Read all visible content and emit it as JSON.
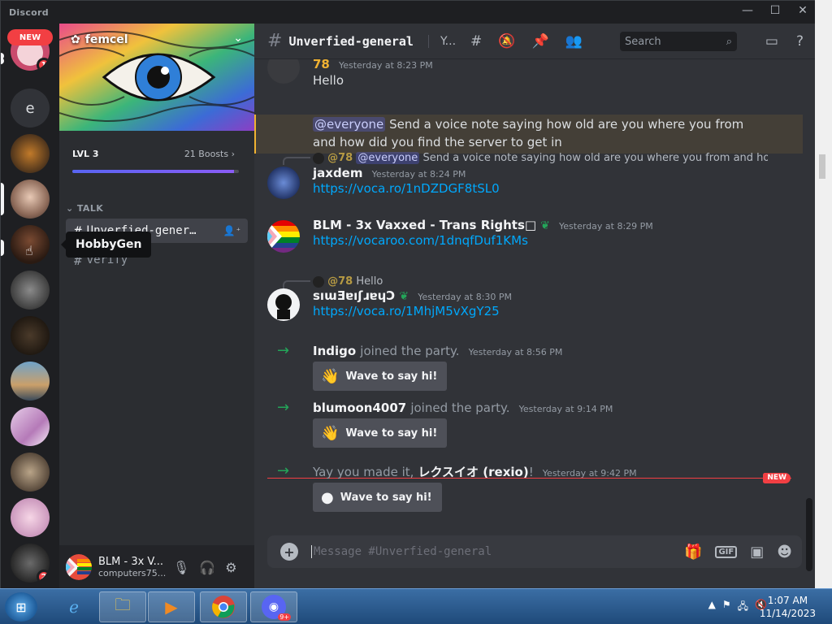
{
  "window": {
    "app_title": "Discord"
  },
  "rail": {
    "new_label": "NEW",
    "home_badge": "3",
    "servers": [
      {
        "name": "server-1",
        "badge": "1"
      },
      {
        "name": "server-e",
        "letter": "e"
      },
      {
        "name": "server-3"
      },
      {
        "name": "server-4"
      },
      {
        "name": "HobbyGen"
      },
      {
        "name": "server-6"
      },
      {
        "name": "server-7"
      },
      {
        "name": "server-8"
      },
      {
        "name": "server-9"
      },
      {
        "name": "server-10"
      },
      {
        "name": "server-11"
      },
      {
        "name": "server-12",
        "badge": "2"
      }
    ],
    "tooltip": "HobbyGen"
  },
  "sidebar": {
    "server_name": "femcel",
    "boost_level": "LVL 3",
    "boosts": "21 Boosts",
    "boost_progress": 0.97,
    "category": "TALK",
    "channels": [
      {
        "name": "Unverfied-gener…",
        "active": true
      },
      {
        "name": "verify",
        "active": false
      }
    ],
    "user": {
      "name": "BLM - 3x V...",
      "tag": "computers75..."
    }
  },
  "header": {
    "channel": "Unverfied-general",
    "topic_short": "Y...",
    "search_placeholder": "Search"
  },
  "messages": [
    {
      "author": "78",
      "time": "Yesterday at 8:23 PM",
      "text": "Hello"
    },
    {
      "mention": "@everyone",
      "text": "Send a voice note saying how old are you where you from and how did you find the server to get in"
    },
    {
      "reply_to": "@78",
      "reply_mention": "@everyone",
      "reply_text": "Send a voice note saying how old are you where you from and how did yo",
      "author": "jaxdem",
      "time": "Yesterday at 8:24 PM",
      "link": "https://voca.ro/1nDZDGF8tSL0"
    },
    {
      "author": "BLM - 3x Vaxxed - Trans Rights□",
      "time": "Yesterday at 8:29 PM",
      "link": "https://vocaroo.com/1dnqfDuf1KMs"
    },
    {
      "reply_to": "@78",
      "reply_text": "Hello",
      "author": "sıɯƎɐıʃɹɐɥƆ",
      "time": "Yesterday at 8:30 PM",
      "link": "https://voca.ro/1MhjM5vXgY25"
    },
    {
      "author": "Indigo",
      "action": "joined the party.",
      "time": "Yesterday at 8:56 PM",
      "wave": "Wave to say hi!"
    },
    {
      "author": "blumoon4007",
      "action": "joined the party.",
      "time": "Yesterday at 9:14 PM",
      "wave": "Wave to say hi!"
    },
    {
      "prefix": "Yay you made it,",
      "author": "レクスイオ (rexio)",
      "suffix": "!",
      "time": "Yesterday at 9:42 PM",
      "wave": "Wave to say hi!"
    }
  ],
  "new_divider": "NEW",
  "composer": {
    "placeholder": "Message #Unverfied-general",
    "gif": "GIF"
  },
  "taskbar": {
    "time": "1:07 AM",
    "date": "11/14/2023",
    "discord_badge": "9+"
  },
  "colors": {
    "accent": "#5865f2",
    "link": "#00a8fc",
    "danger": "#f23f43",
    "online": "#23a559"
  }
}
